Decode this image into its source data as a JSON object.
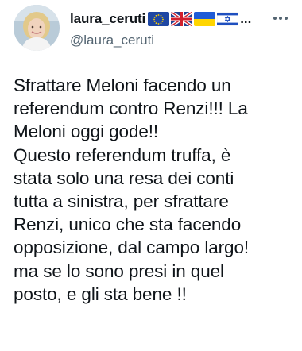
{
  "author": {
    "display_name": "laura_ceruti",
    "flags": [
      "european-union-flag",
      "united-kingdom-flag",
      "ukraine-flag",
      "israel-flag"
    ],
    "name_overflow": "...",
    "handle": "@laura_ceruti"
  },
  "tweet": {
    "text": "Sfrattare Meloni facendo un\nreferendum contro Renzi!!! La\nMeloni oggi gode!!\nQuesto referendum truffa, è\nstata solo una resa dei conti\ntutta a sinistra, per sfrattare\nRenzi, unico che sta facendo\nopposizione, dal campo largo!\nma se lo sono presi in quel\nposto, e gli sta bene !!"
  },
  "icons": {
    "more": "more-options-icon",
    "avatar": "avatar"
  },
  "colors": {
    "text": "#0f1419",
    "secondary": "#536471",
    "background": "#ffffff"
  }
}
